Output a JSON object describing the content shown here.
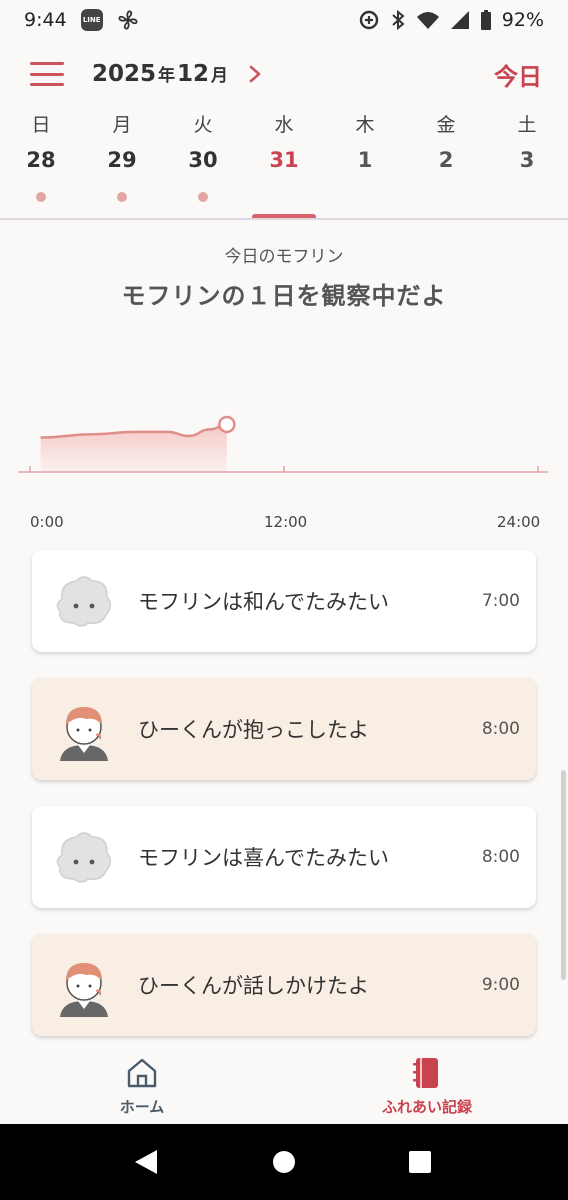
{
  "status_bar": {
    "time": "9:44",
    "line_badge": "LINE",
    "battery_percent": "92%",
    "icons": [
      "line-icon",
      "fan-icon",
      "data-saver-icon",
      "bluetooth-icon",
      "wifi-icon",
      "signal-icon",
      "battery-icon"
    ]
  },
  "header": {
    "year": "2025",
    "year_unit": "年",
    "month": "12",
    "month_unit": "月",
    "today_label": "今日"
  },
  "week": [
    {
      "dow": "日",
      "date": "28",
      "has_record": true,
      "state": "past"
    },
    {
      "dow": "月",
      "date": "29",
      "has_record": true,
      "state": "past"
    },
    {
      "dow": "火",
      "date": "30",
      "has_record": true,
      "state": "past"
    },
    {
      "dow": "水",
      "date": "31",
      "has_record": false,
      "state": "selected"
    },
    {
      "dow": "木",
      "date": "1",
      "has_record": false,
      "state": "future"
    },
    {
      "dow": "金",
      "date": "2",
      "has_record": false,
      "state": "future"
    },
    {
      "dow": "土",
      "date": "3",
      "has_record": false,
      "state": "future"
    }
  ],
  "section": {
    "subtitle": "今日のモフリン",
    "title": "モフリンの１日を観察中だよ"
  },
  "chart_data": {
    "type": "area",
    "x_tick_labels": [
      "0:00",
      "12:00",
      "24:00"
    ],
    "x_range_hours": [
      0,
      24
    ],
    "y_range": [
      0,
      1
    ],
    "points": [
      {
        "x": 0.5,
        "y": 0.42
      },
      {
        "x": 3,
        "y": 0.46
      },
      {
        "x": 5,
        "y": 0.49
      },
      {
        "x": 6.5,
        "y": 0.49
      },
      {
        "x": 7.5,
        "y": 0.44
      },
      {
        "x": 8.5,
        "y": 0.52
      },
      {
        "x": 9.3,
        "y": 0.58
      }
    ],
    "grid": false,
    "colors": {
      "line": "#e08e89",
      "fill": "#f6c7c5",
      "axis": "#e3a3a5"
    }
  },
  "records": [
    {
      "text": "モフリンは和んでたみたい",
      "time": "7:00",
      "who": "mofurin",
      "style": "white",
      "avatar_icon": "mofurin-avatar-icon"
    },
    {
      "text": "ひーくんが抱っこしたよ",
      "time": "8:00",
      "who": "user",
      "style": "beige",
      "avatar_icon": "boy-avatar-icon"
    },
    {
      "text": "モフリンは喜んでたみたい",
      "time": "8:00",
      "who": "mofurin",
      "style": "white",
      "avatar_icon": "mofurin-avatar-icon"
    },
    {
      "text": "ひーくんが話しかけたよ",
      "time": "9:00",
      "who": "user",
      "style": "beige",
      "avatar_icon": "boy-avatar-icon"
    }
  ],
  "bottom_nav": {
    "home_label": "ホーム",
    "records_label": "ふれあい記録",
    "active": "records",
    "colors": {
      "active": "#c9424f",
      "inactive": "#4a5b6b"
    }
  },
  "colors": {
    "accent": "#c9424f",
    "background": "#fbf9f7",
    "beige_card": "#f8eee4"
  }
}
